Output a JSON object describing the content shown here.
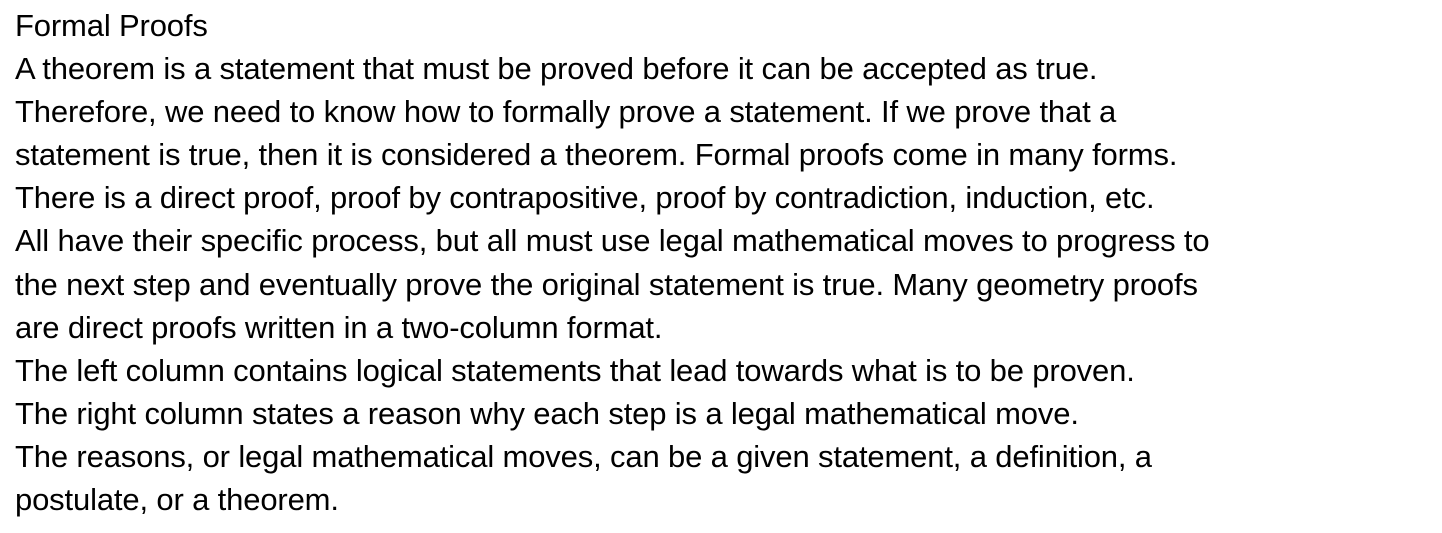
{
  "title": "Formal Proofs",
  "paragraphs": [
    {
      "lines": [
        "A theorem is a statement that must be proved before it can be accepted as true.",
        "Therefore, we need to know how to formally prove a statement.  If we prove that a",
        "statement is true, then it is considered a theorem.  Formal proofs come in many forms.",
        "There is a direct proof, proof by contrapositive, proof by contradiction, induction, etc."
      ]
    },
    {
      "lines": [
        "All have their specific process, but all must use legal mathematical moves to progress to",
        "the next step and eventually prove the original statement is true. Many geometry proofs",
        "are direct proofs written in a two-column format."
      ]
    },
    {
      "lines": [
        "The left column contains logical statements that lead towards what is to be proven."
      ]
    },
    {
      "lines": [
        "The right column states a reason why each step is a legal mathematical move."
      ]
    },
    {
      "lines": [
        "The reasons, or legal mathematical moves, can be a given statement, a definition, a",
        "postulate, or a theorem."
      ]
    }
  ]
}
